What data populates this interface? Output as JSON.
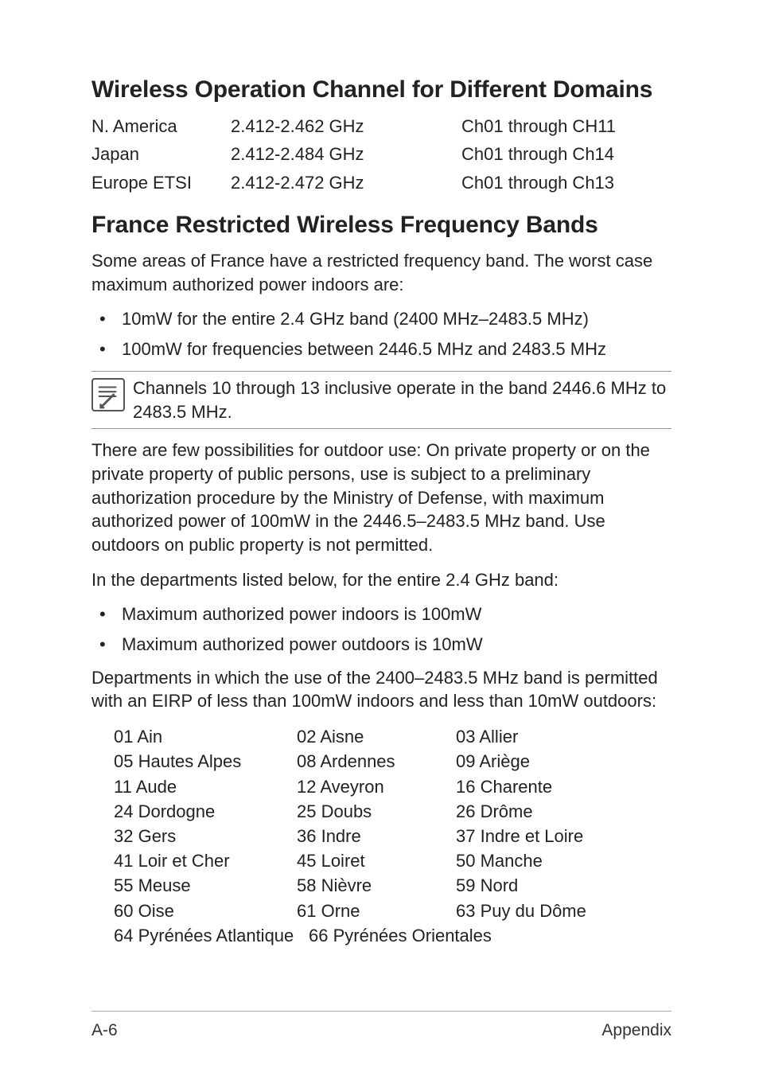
{
  "h1": "Wireless Operation Channel for Different Domains",
  "domains": [
    {
      "region": "N. America",
      "freq": "2.412-2.462 GHz",
      "ch": "Ch01 through CH11"
    },
    {
      "region": "Japan",
      "freq": "2.412-2.484 GHz",
      "ch": "Ch01 through Ch14"
    },
    {
      "region": "Europe ETSI",
      "freq": "2.412-2.472 GHz",
      "ch": "Ch01 through Ch13"
    }
  ],
  "h2": "France Restricted Wireless Frequency Bands",
  "p1": "Some areas of France have a restricted frequency band. The worst case maximum authorized power indoors are:",
  "b1": [
    "10mW for the entire 2.4 GHz band (2400 MHz–2483.5 MHz)",
    "100mW for frequencies between 2446.5 MHz and 2483.5 MHz"
  ],
  "note": "Channels 10 through 13 inclusive operate in the band 2446.6 MHz to 2483.5 MHz.",
  "p2": "There are few possibilities for outdoor use: On private property or on the private property of public persons, use is subject to a preliminary authorization procedure by the Ministry of Defense, with maximum authorized power of 100mW in the 2446.5–2483.5 MHz band. Use outdoors on public property is not permitted.",
  "p3": "In the departments listed below, for the entire 2.4 GHz band:",
  "b2": [
    "Maximum authorized power indoors is 100mW",
    "Maximum authorized power outdoors is 10mW"
  ],
  "p4": "Departments in which the use of the 2400–2483.5 MHz band is permitted with an EIRP of less than 100mW indoors and less than 10mW outdoors:",
  "depts": [
    [
      "01  Ain",
      "02  Aisne",
      "03  Allier"
    ],
    [
      "05  Hautes Alpes",
      "08  Ardennes",
      "09  Ariège"
    ],
    [
      "11  Aude",
      "12  Aveyron",
      "16  Charente"
    ],
    [
      "24  Dordogne",
      "25  Doubs",
      "26  Drôme"
    ],
    [
      "32  Gers",
      "36  Indre",
      "37  Indre et Loire"
    ],
    [
      "41  Loir et Cher",
      "45  Loiret",
      "50  Manche"
    ],
    [
      "55  Meuse",
      "58  Nièvre",
      "59  Nord"
    ],
    [
      "60  Oise",
      "61  Orne",
      "63  Puy du Dôme"
    ],
    [
      "64  Pyrénées Atlantique",
      "66  Pyrénées Orientales",
      ""
    ]
  ],
  "footer": {
    "left": "A-6",
    "right": "Appendix"
  }
}
